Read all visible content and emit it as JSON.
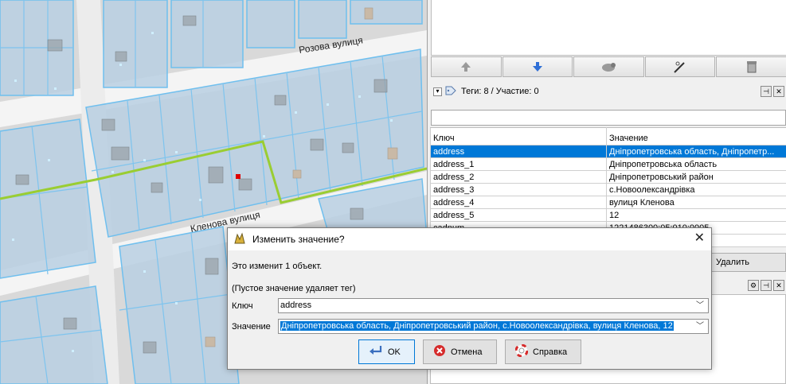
{
  "map": {
    "street_labels": [
      "Розова вулиця",
      "Кленова вулиця"
    ]
  },
  "toolbar": {
    "buttons": [
      {
        "icon": "move-up-icon"
      },
      {
        "icon": "move-down-icon"
      },
      {
        "icon": "sheep-icon"
      },
      {
        "icon": "wand-icon"
      },
      {
        "icon": "trash-icon"
      }
    ]
  },
  "tags_panel": {
    "title": "Теги: 8 / Участие: 0",
    "columns": [
      "Ключ",
      "Значение"
    ],
    "rows": [
      {
        "key": "address",
        "value": "Дніпропетровська область, Дніпропетр..."
      },
      {
        "key": "address_1",
        "value": "Дніпропетровська область"
      },
      {
        "key": "address_2",
        "value": "Дніпропетровський район"
      },
      {
        "key": "address_3",
        "value": "с.Новоолександрівка"
      },
      {
        "key": "address_4",
        "value": "вулиця Кленова"
      },
      {
        "key": "address_5",
        "value": "12"
      },
      {
        "key": "cadnum",
        "value": "1221486300:05:010:0005"
      },
      {
        "key": "",
        "value": "обслуговування..."
      }
    ],
    "selected_row": 0
  },
  "delete_button": {
    "label": "Удалить"
  },
  "dialog": {
    "title": "Изменить значение?",
    "message": "Это изменит 1 объект.",
    "hint": "(Пустое значение удаляет тег)",
    "key_label": "Ключ",
    "key_value": "address",
    "value_label": "Значение",
    "value_value": "Дніпропетровська область, Дніпропетровський район, с.Новоолександрівка, вулиця Кленова, 12",
    "ok_label": "OK",
    "cancel_label": "Отмена",
    "help_label": "Справка"
  },
  "colors": {
    "selection": "#0078d7",
    "parcel_fill": "#b9cfe2",
    "parcel_stroke": "#7ec4ee",
    "route": "#9acd32"
  }
}
